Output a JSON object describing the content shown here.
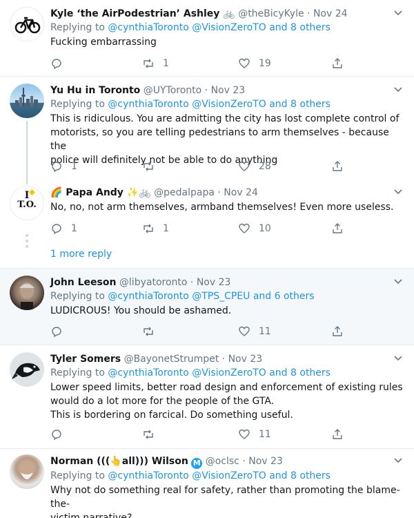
{
  "tweets": [
    {
      "name": "Kyle ‘the AirPodestrian’ Ashley 🚲",
      "handle": "@theBicyKyle",
      "date": "Nov 24",
      "reply_prefix": "Replying to",
      "reply_to": "@cynthiaToronto @VisionZeroTO and 8 others",
      "text": "Fucking embarrassing",
      "replies": "",
      "retweets": "1",
      "likes": "19"
    },
    {
      "name": "Yu Hu in Toronto",
      "handle": "@UYToronto",
      "date": "Nov 23",
      "reply_prefix": "Replying to",
      "reply_to": "@cynthiaToronto @VisionZeroTO and 8 others",
      "text": "This is ridiculous. You are admitting the city has lost complete control of\nmotorists, so you are telling pedestrians to arm themselves - because the\npolice will definitely not be able to do anything",
      "replies": "1",
      "retweets": "",
      "likes": "28"
    },
    {
      "name": "🌈 Papa Andy ✨🚲",
      "handle": "@pedalpapa",
      "date": "Nov 24",
      "text": "No, no, not arm themselves, armband themselves! Even more useless.",
      "replies": "1",
      "retweets": "1",
      "likes": "10"
    },
    {
      "name": "John Leeson",
      "handle": "@libyatoronto",
      "date": "Nov 23",
      "reply_prefix": "Replying to",
      "reply_to": "@cynthiaToronto @TPS_CPEU and 6 others",
      "text": "LUDICROUS! You should be ashamed.",
      "replies": "",
      "retweets": "",
      "likes": "11"
    },
    {
      "name": "Tyler Somers",
      "handle": "@BayonetStrumpet",
      "date": "Nov 23",
      "reply_prefix": "Replying to",
      "reply_to": "@cynthiaToronto @VisionZeroTO and 8 others",
      "text": "Lower speed limits, better road design  and enforcement of existing rules\nwould do a lot more for the people of the GTA.\nThis is bordering on farcical. Do something useful.",
      "replies": "",
      "retweets": "",
      "likes": "11"
    },
    {
      "name": "Norman (((👆all))) Wilson",
      "handle": "@oclsc",
      "date": "Nov 23",
      "reply_prefix": "Replying to",
      "reply_to": "@cynthiaToronto @VisionZeroTO and 8 others",
      "text": "Why not do something real for safety, rather than promoting the blame-the-\nvictim narrative?",
      "replies": "",
      "retweets": "",
      "likes": ""
    }
  ],
  "more_replies": "1 more reply",
  "verified_badge": "M",
  "avatar_text": {
    "line1": "I",
    "line2": "T.O."
  },
  "colors": {
    "link": "#1b95e0",
    "muted": "#657786",
    "divider": "#e6ecf0"
  }
}
